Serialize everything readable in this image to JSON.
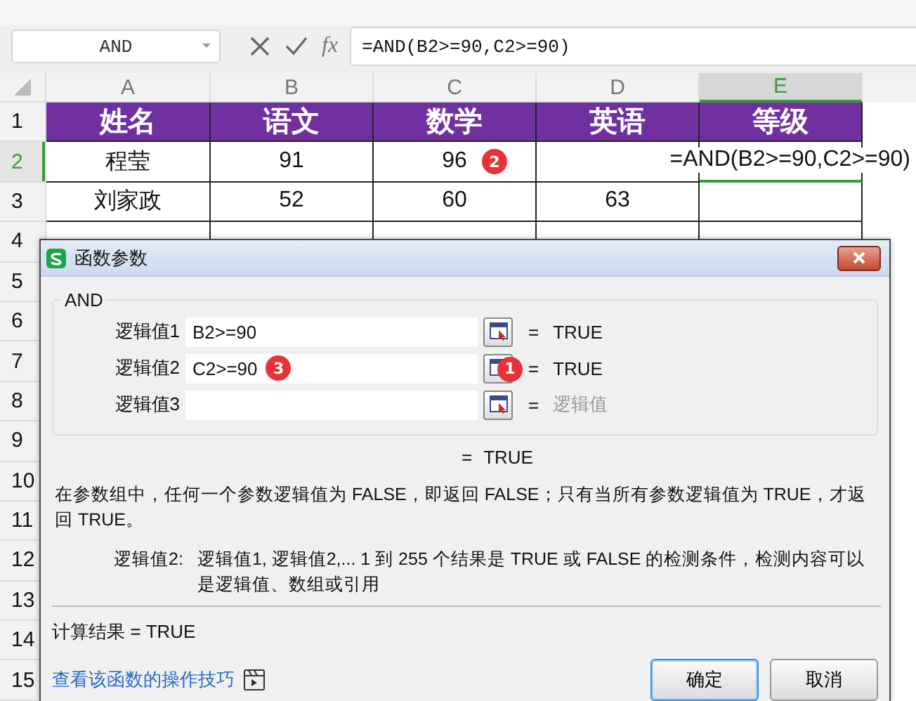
{
  "name_box": {
    "value": "AND"
  },
  "formula_bar": {
    "fx": "fx",
    "value": "=AND(B2>=90,C2>=90)"
  },
  "columns": [
    {
      "label": "A",
      "selected": false
    },
    {
      "label": "B",
      "selected": false
    },
    {
      "label": "C",
      "selected": false
    },
    {
      "label": "D",
      "selected": false
    },
    {
      "label": "E",
      "selected": true
    }
  ],
  "rows": [
    {
      "label": "1",
      "selected": false,
      "kind": "header",
      "cells": [
        "姓名",
        "语文",
        "数学",
        "英语",
        "等级"
      ]
    },
    {
      "label": "2",
      "selected": true,
      "kind": "data",
      "cells": [
        {
          "text": "程莹"
        },
        {
          "text": "91"
        },
        {
          "text": "96",
          "badge": "2"
        },
        {},
        {
          "editing": "=AND(B2>=90,C2>=90)"
        }
      ]
    },
    {
      "label": "3",
      "selected": false,
      "kind": "data",
      "cells": [
        {
          "text": "刘家政"
        },
        {
          "text": "52"
        },
        {
          "text": "60"
        },
        {
          "text": "63"
        },
        {}
      ]
    },
    {
      "label": "4",
      "selected": false,
      "kind": "data",
      "cells": [
        {},
        {},
        {},
        {},
        {}
      ]
    },
    {
      "label": "5",
      "selected": false,
      "kind": "blank"
    },
    {
      "label": "6",
      "selected": false,
      "kind": "blank"
    },
    {
      "label": "7",
      "selected": false,
      "kind": "blank"
    },
    {
      "label": "8",
      "selected": false,
      "kind": "blank"
    },
    {
      "label": "9",
      "selected": false,
      "kind": "blank"
    },
    {
      "label": "10",
      "selected": false,
      "kind": "blank"
    },
    {
      "label": "11",
      "selected": false,
      "kind": "blank"
    },
    {
      "label": "12",
      "selected": false,
      "kind": "blank"
    },
    {
      "label": "13",
      "selected": false,
      "kind": "blank"
    },
    {
      "label": "14",
      "selected": false,
      "kind": "blank"
    },
    {
      "label": "15",
      "selected": false,
      "kind": "blank"
    }
  ],
  "dialog": {
    "title": "函数参数",
    "function_name": "AND",
    "arguments": [
      {
        "label": "逻辑值1",
        "value": "B2>=90",
        "equals": "=",
        "result": "TRUE",
        "dimmed": false
      },
      {
        "label": "逻辑值2",
        "value": "C2>=90",
        "badge": "3",
        "button_badge": "1",
        "equals": "=",
        "result": "TRUE",
        "dimmed": false
      },
      {
        "label": "逻辑值3",
        "equals": "=",
        "result": "逻辑值",
        "dimmed": true
      }
    ],
    "overall": {
      "equals": "=",
      "result": "TRUE"
    },
    "description": "在参数组中，任何一个参数逻辑值为 FALSE，即返回 FALSE；只有当所有参数逻辑值为 TRUE，才返回 TRUE。",
    "help": {
      "label": "逻辑值2:",
      "text": "逻辑值1, 逻辑值2,... 1 到 255 个结果是 TRUE 或 FALSE 的检测条件，检测内容可以是逻辑值、数组或引用"
    },
    "calc_result": "计算结果 = TRUE",
    "link": "查看该函数的操作技巧",
    "buttons": [
      {
        "label": "确定",
        "default": true
      },
      {
        "label": "取消",
        "default": false
      }
    ]
  }
}
